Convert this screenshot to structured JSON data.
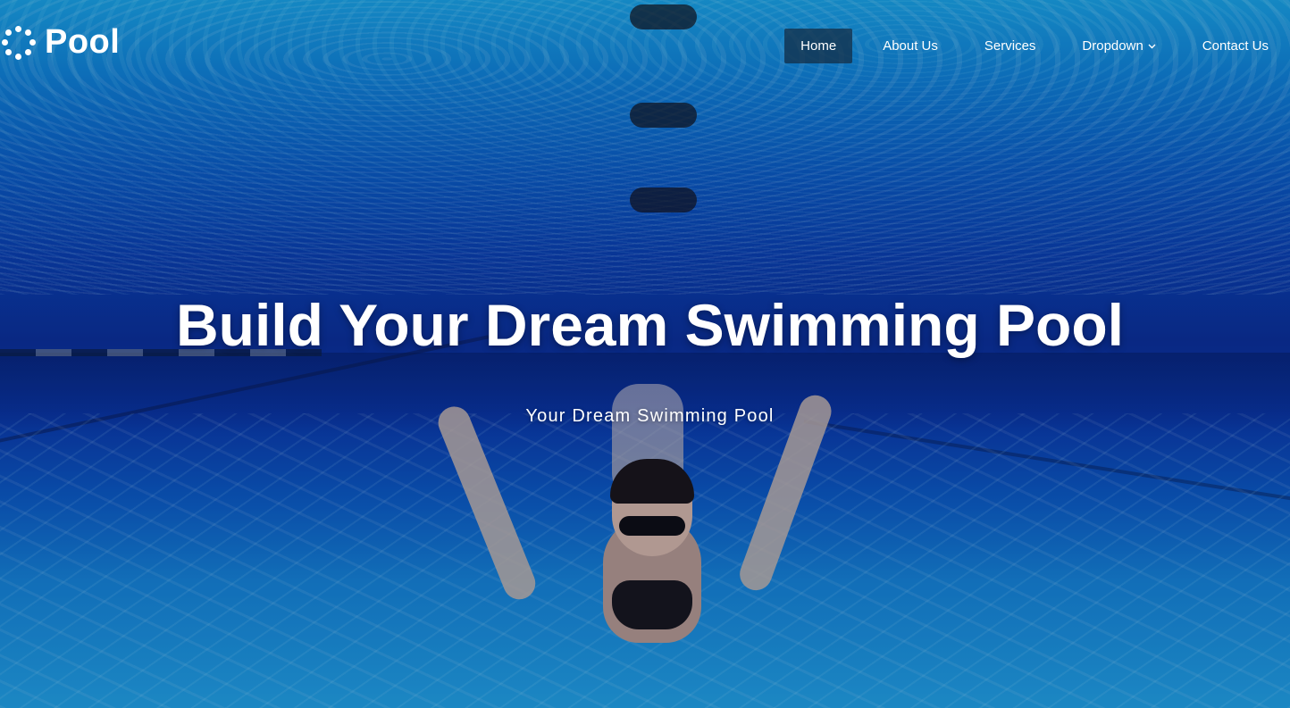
{
  "brand": {
    "name": "Pool",
    "icon": "spinner-dots-icon"
  },
  "nav": {
    "items": [
      {
        "label": "Home",
        "active": true
      },
      {
        "label": "About Us",
        "active": false
      },
      {
        "label": "Services",
        "active": false
      },
      {
        "label": "Dropdown",
        "active": false,
        "icon": "chevron-down-icon"
      },
      {
        "label": "Contact Us",
        "active": false
      }
    ]
  },
  "hero": {
    "title": "Build Your Dream Swimming Pool",
    "subtitle": "Your Dream Swimming Pool",
    "background": "underwater-swimmer-photo"
  },
  "colors": {
    "water_dark": "#0b2f98",
    "water_light": "#22a3e6",
    "nav_active_bg": "#142d46"
  }
}
